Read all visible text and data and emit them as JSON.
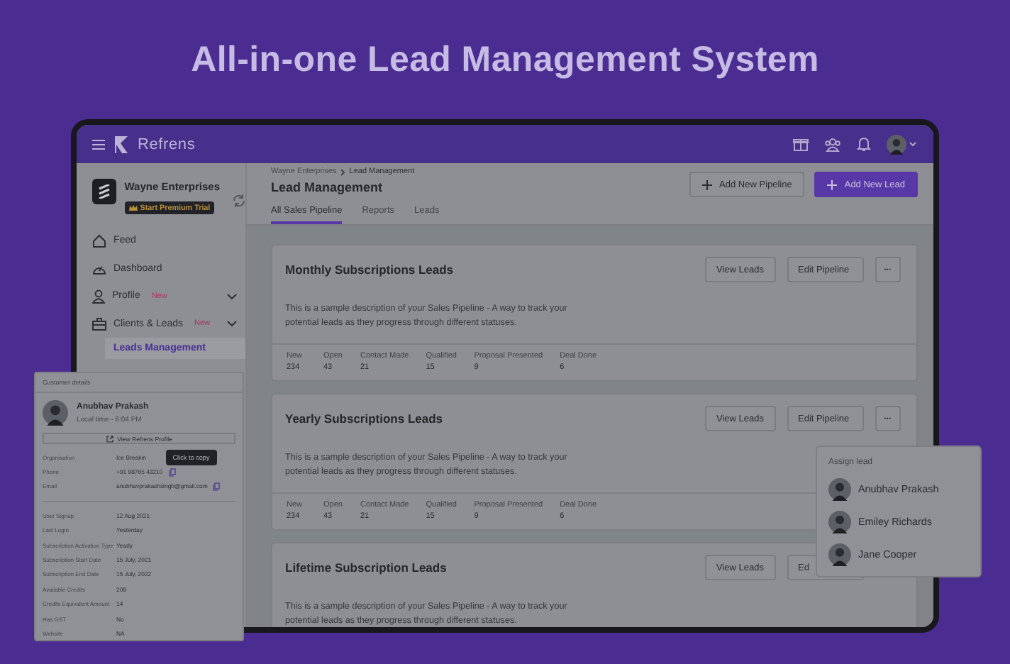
{
  "headline": "All-in-one Lead Management System",
  "app_header": {
    "brand": "Refrens"
  },
  "sidebar": {
    "org_name": "Wayne Enterprises",
    "trial_badge": "Start Premium Trial",
    "items": [
      {
        "label": "Feed",
        "kind": "link"
      },
      {
        "label": "Dashboard",
        "kind": "link"
      },
      {
        "label": "Profile",
        "badge": "New",
        "kind": "group"
      },
      {
        "label": "Clients & Leads",
        "badge": "New",
        "kind": "group",
        "children": [
          {
            "label": "Leads Management",
            "selected": true
          }
        ]
      }
    ]
  },
  "main": {
    "breadcrumb": [
      "Wayne Enterprises",
      "Lead Management"
    ],
    "title": "Lead Management",
    "buttons": [
      {
        "label": "Add New Pipeline",
        "kind": "secondary"
      },
      {
        "label": "Add New Lead",
        "kind": "primary"
      }
    ],
    "tabs": [
      {
        "label": "All Sales Pipeline",
        "selected": true
      },
      {
        "label": "Reports",
        "selected": false
      },
      {
        "label": "Leads",
        "selected": false
      }
    ],
    "pipelines": [
      {
        "title": "Monthly Subscriptions Leads",
        "actions": [
          {
            "kind": "button",
            "label": "View Leads"
          },
          {
            "kind": "button",
            "label": "Edit Pipeline"
          },
          {
            "kind": "more",
            "label": "···"
          }
        ],
        "description": "This is a sample description of your Sales Pipeline - A way to track your potential leads as they progress through different statuses.",
        "stats": [
          {
            "label": "New",
            "value": "234"
          },
          {
            "label": "Open",
            "value": "43"
          },
          {
            "label": "Contact Made",
            "value": "21"
          },
          {
            "label": "Qualified",
            "value": "15"
          },
          {
            "label": "Proposal Presented",
            "value": "9"
          },
          {
            "label": "Deal Done",
            "value": "6"
          }
        ]
      },
      {
        "title": "Yearly Subscriptions Leads",
        "actions": [
          {
            "kind": "button",
            "label": "View Leads"
          },
          {
            "kind": "button",
            "label": "Edit Pipeline"
          },
          {
            "kind": "more",
            "label": "···"
          }
        ],
        "description": "This is a sample description of your Sales Pipeline - A way to track your potential leads as they progress through different statuses.",
        "stats": [
          {
            "label": "New",
            "value": "234"
          },
          {
            "label": "Open",
            "value": "43"
          },
          {
            "label": "Contact Made",
            "value": "21"
          },
          {
            "label": "Qualified",
            "value": "15"
          },
          {
            "label": "Proposal Presented",
            "value": "9"
          },
          {
            "label": "Deal Done",
            "value": "6"
          }
        ]
      },
      {
        "title": "Lifetime Subscription Leads",
        "actions": [
          {
            "kind": "button",
            "label": "View Leads"
          },
          {
            "kind": "button",
            "label": "Ed"
          }
        ],
        "description": "This is a sample description of your Sales Pipeline - A way to track your potential leads as they progress through different statuses."
      }
    ]
  },
  "customer_details": {
    "title": "Customer details",
    "name": "Anubhav Prakash",
    "local_time": "Local time - 6:04 PM",
    "profile_button": "View Refrens Profile",
    "contact": [
      {
        "label": "Organisation",
        "value": "Ice Breakin",
        "copy": false
      },
      {
        "label": "Phone",
        "value": "+91 98765 43210",
        "copy": true
      },
      {
        "label": "Email",
        "value": "anubhavprakashsingh@gmail.com",
        "copy": true
      }
    ],
    "tooltip": "Click to copy",
    "details": [
      {
        "label": "User Signup",
        "value": "12 Aug 2021"
      },
      {
        "label": "Last Login",
        "value": "Yesterday"
      },
      {
        "label": "Subscription Activation Type",
        "value": "Yearly"
      },
      {
        "label": "Subscription Start Date",
        "value": "15 July, 2021"
      },
      {
        "label": "Subscription End Date",
        "value": "15 July, 2022"
      },
      {
        "label": "Available Credits",
        "value": "208"
      },
      {
        "label": "Credits Equivalent Amount",
        "value": "14"
      },
      {
        "label": "Has GST",
        "value": "No"
      },
      {
        "label": "Website",
        "value": "NA"
      }
    ]
  },
  "assign_menu": {
    "title": "Assign lead",
    "people": [
      {
        "name": "Anubhav Prakash"
      },
      {
        "name": "Emiley Richards"
      },
      {
        "name": "Jane Cooper"
      }
    ]
  }
}
